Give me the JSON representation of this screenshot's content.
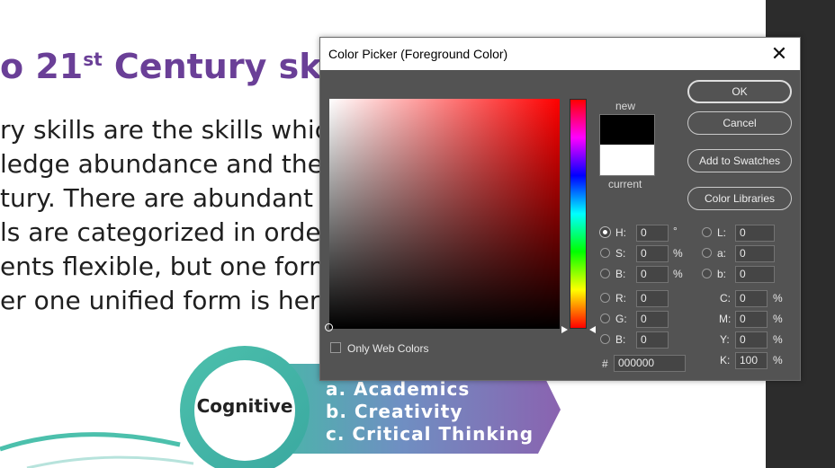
{
  "slide": {
    "heading_prefix": "o 21",
    "heading_sup": "st",
    "heading_suffix": " Century skills",
    "lines": [
      "ry skills are the skills which",
      "ledge abundance and the",
      "tury. There are abundant v",
      "ls are categorized in orde",
      "ents flexible, but one form",
      "er one unified form is here"
    ],
    "cognitive_label": "Cognitive",
    "skills": [
      "a.  Academics",
      "b.  Creativity",
      "c.  Critical Thinking"
    ]
  },
  "dialog": {
    "title": "Color Picker (Foreground Color)",
    "close_glyph": "✕",
    "new_label": "new",
    "current_label": "current",
    "new_color": "#000000",
    "current_color": "#ffffff",
    "buttons": {
      "ok": "OK",
      "cancel": "Cancel",
      "add_to_swatches": "Add to Swatches",
      "color_libraries": "Color Libraries"
    },
    "hsb": [
      {
        "label": "H:",
        "value": "0",
        "unit": "°"
      },
      {
        "label": "S:",
        "value": "0",
        "unit": "%"
      },
      {
        "label": "B:",
        "value": "0",
        "unit": "%"
      }
    ],
    "lab": [
      {
        "label": "L:",
        "value": "0"
      },
      {
        "label": "a:",
        "value": "0"
      },
      {
        "label": "b:",
        "value": "0"
      }
    ],
    "rgb": [
      {
        "label": "R:",
        "value": "0"
      },
      {
        "label": "G:",
        "value": "0"
      },
      {
        "label": "B:",
        "value": "0"
      }
    ],
    "cmyk": [
      {
        "label": "C:",
        "value": "0",
        "unit": "%"
      },
      {
        "label": "M:",
        "value": "0",
        "unit": "%"
      },
      {
        "label": "Y:",
        "value": "0",
        "unit": "%"
      },
      {
        "label": "K:",
        "value": "100",
        "unit": "%"
      }
    ],
    "hex_label": "#",
    "hex_value": "000000",
    "only_web_colors": "Only Web Colors"
  }
}
